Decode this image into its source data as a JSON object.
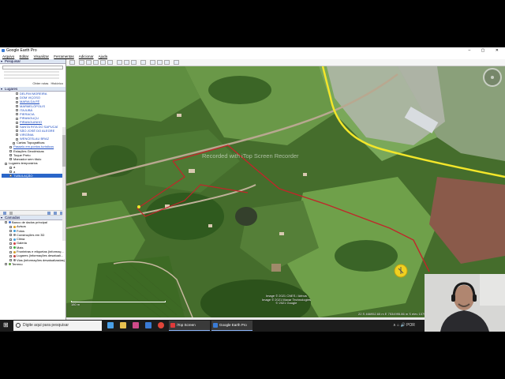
{
  "window": {
    "title": "Google Earth Pro",
    "controls": "–  ▢  ✕"
  },
  "menu": [
    "Arquivo",
    "Editar",
    "Visualizar",
    "Ferramentas",
    "Adicionar",
    "Ajuda"
  ],
  "search_panel": {
    "header": "Pesquisar",
    "links": [
      "Obter rotas",
      "Histórico"
    ]
  },
  "places_panel": {
    "header": "Lugares",
    "items": [
      {
        "label": "DELFIM MOREIRA",
        "link": true
      },
      {
        "label": "DOM VIÇOSO",
        "link": true
      },
      {
        "label": "MARIA DA FÉ",
        "link": true
      },
      {
        "label": "MARMELÓPOLIS",
        "link": true
      },
      {
        "label": "ITAJUBÁ",
        "link": true
      },
      {
        "label": "PIERACIA",
        "link": true
      },
      {
        "label": "PIRANGUÇU",
        "link": true
      },
      {
        "label": "PIRANGUINHO",
        "link": true
      },
      {
        "label": "SANTA RITA DO SAPUCAÍ",
        "link": true
      },
      {
        "label": "SÃO JOSÉ DO ALEGRE",
        "link": true
      },
      {
        "label": "VIRGÍNIA",
        "link": true
      },
      {
        "label": "WENCESLAU BRAZ",
        "link": true
      },
      {
        "label": "Cartas Topográficas",
        "link": false
      },
      {
        "label": "Passeio em pontos turísticos",
        "link": true
      },
      {
        "label": "Estações Geodésicas",
        "link": false
      },
      {
        "label": "Toque Preto",
        "link": false
      },
      {
        "label": "Marcador sem título",
        "link": false
      },
      {
        "label": "Lugares temporários",
        "link": false
      },
      {
        "label": "a",
        "link": false
      },
      {
        "label": "a",
        "link": false
      },
      {
        "label": "TUBULAÇÃO",
        "link": false,
        "selected": true
      }
    ]
  },
  "layers_panel": {
    "header": "Camadas",
    "items": [
      {
        "label": "Banco de dados principal",
        "color": "#3a6fd8"
      },
      {
        "label": "Avisos",
        "color": "#e0a020"
      },
      {
        "label": "Fotos",
        "color": "#3aa0e0"
      },
      {
        "label": "Construções em 3D",
        "color": "#888888"
      },
      {
        "label": "Clima",
        "color": "#40a0e0"
      },
      {
        "label": "Galeria",
        "color": "#d04040"
      },
      {
        "label": "Mais",
        "color": "#40b040"
      },
      {
        "label": "Fronteiras e etiquetas (informaç...",
        "color": "#d0a030"
      },
      {
        "label": "Lugares (informações desatuali...",
        "color": "#c04040"
      },
      {
        "label": "Vias (informações desatualizadas)",
        "color": "#808080"
      },
      {
        "label": "Terreno",
        "color": "#60a040"
      }
    ]
  },
  "map": {
    "watermark": "Recorded with iTop Screen Recorder",
    "imagery_credits": [
      "Image © 2021 CNES / Airbus",
      "Image © 2021 Maxar Technologies",
      "© 2021 Google"
    ],
    "scale_label": "180 m",
    "coords": "22 S  466952.65 m E  7534995.86 m S    elev  1079 m    alt ocular  1.32 km",
    "colors": {
      "road": "#f3e62a",
      "boundary": "#c0262a"
    }
  },
  "taskbar": {
    "search_placeholder": "Digite aqui para pesquisar",
    "apps": [
      {
        "label": "iTop Screen Recorder",
        "color": "#e03a3a"
      },
      {
        "label": "Google Earth Pro",
        "color": "#3a7bd5"
      }
    ],
    "tray": "∧  ⌂  🔊  POR"
  }
}
